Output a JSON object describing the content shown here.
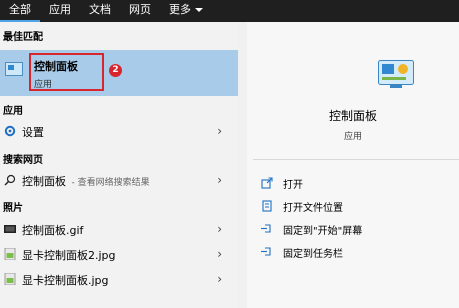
{
  "tabs": [
    {
      "label": "全部"
    },
    {
      "label": "应用"
    },
    {
      "label": "文档"
    },
    {
      "label": "网页"
    },
    {
      "label": "更多"
    }
  ],
  "sections": {
    "best_match": "最佳匹配",
    "apps": "应用",
    "web": "搜索网页",
    "photos": "照片"
  },
  "best_match": {
    "title": "控制面板",
    "subtitle": "应用",
    "badge": "2"
  },
  "apps_items": [
    {
      "label": "设置"
    }
  ],
  "web_items": [
    {
      "label": "控制面板",
      "hint": "- 查看网络搜索结果"
    }
  ],
  "photo_items": [
    {
      "label": "控制面板.gif"
    },
    {
      "label": "显卡控制面板2.jpg"
    },
    {
      "label": "显卡控制面板.jpg"
    }
  ],
  "detail": {
    "title": "控制面板",
    "subtitle": "应用",
    "actions": [
      {
        "label": "打开"
      },
      {
        "label": "打开文件位置"
      },
      {
        "label": "固定到\"开始\"屏幕"
      },
      {
        "label": "固定到任务栏"
      }
    ]
  },
  "colors": {
    "tabbar_bg": "#1f1f1f",
    "tab_active_underline": "#4fa3e6",
    "selected_bg": "#a7cbe9",
    "annotation_red": "#d9262e"
  }
}
